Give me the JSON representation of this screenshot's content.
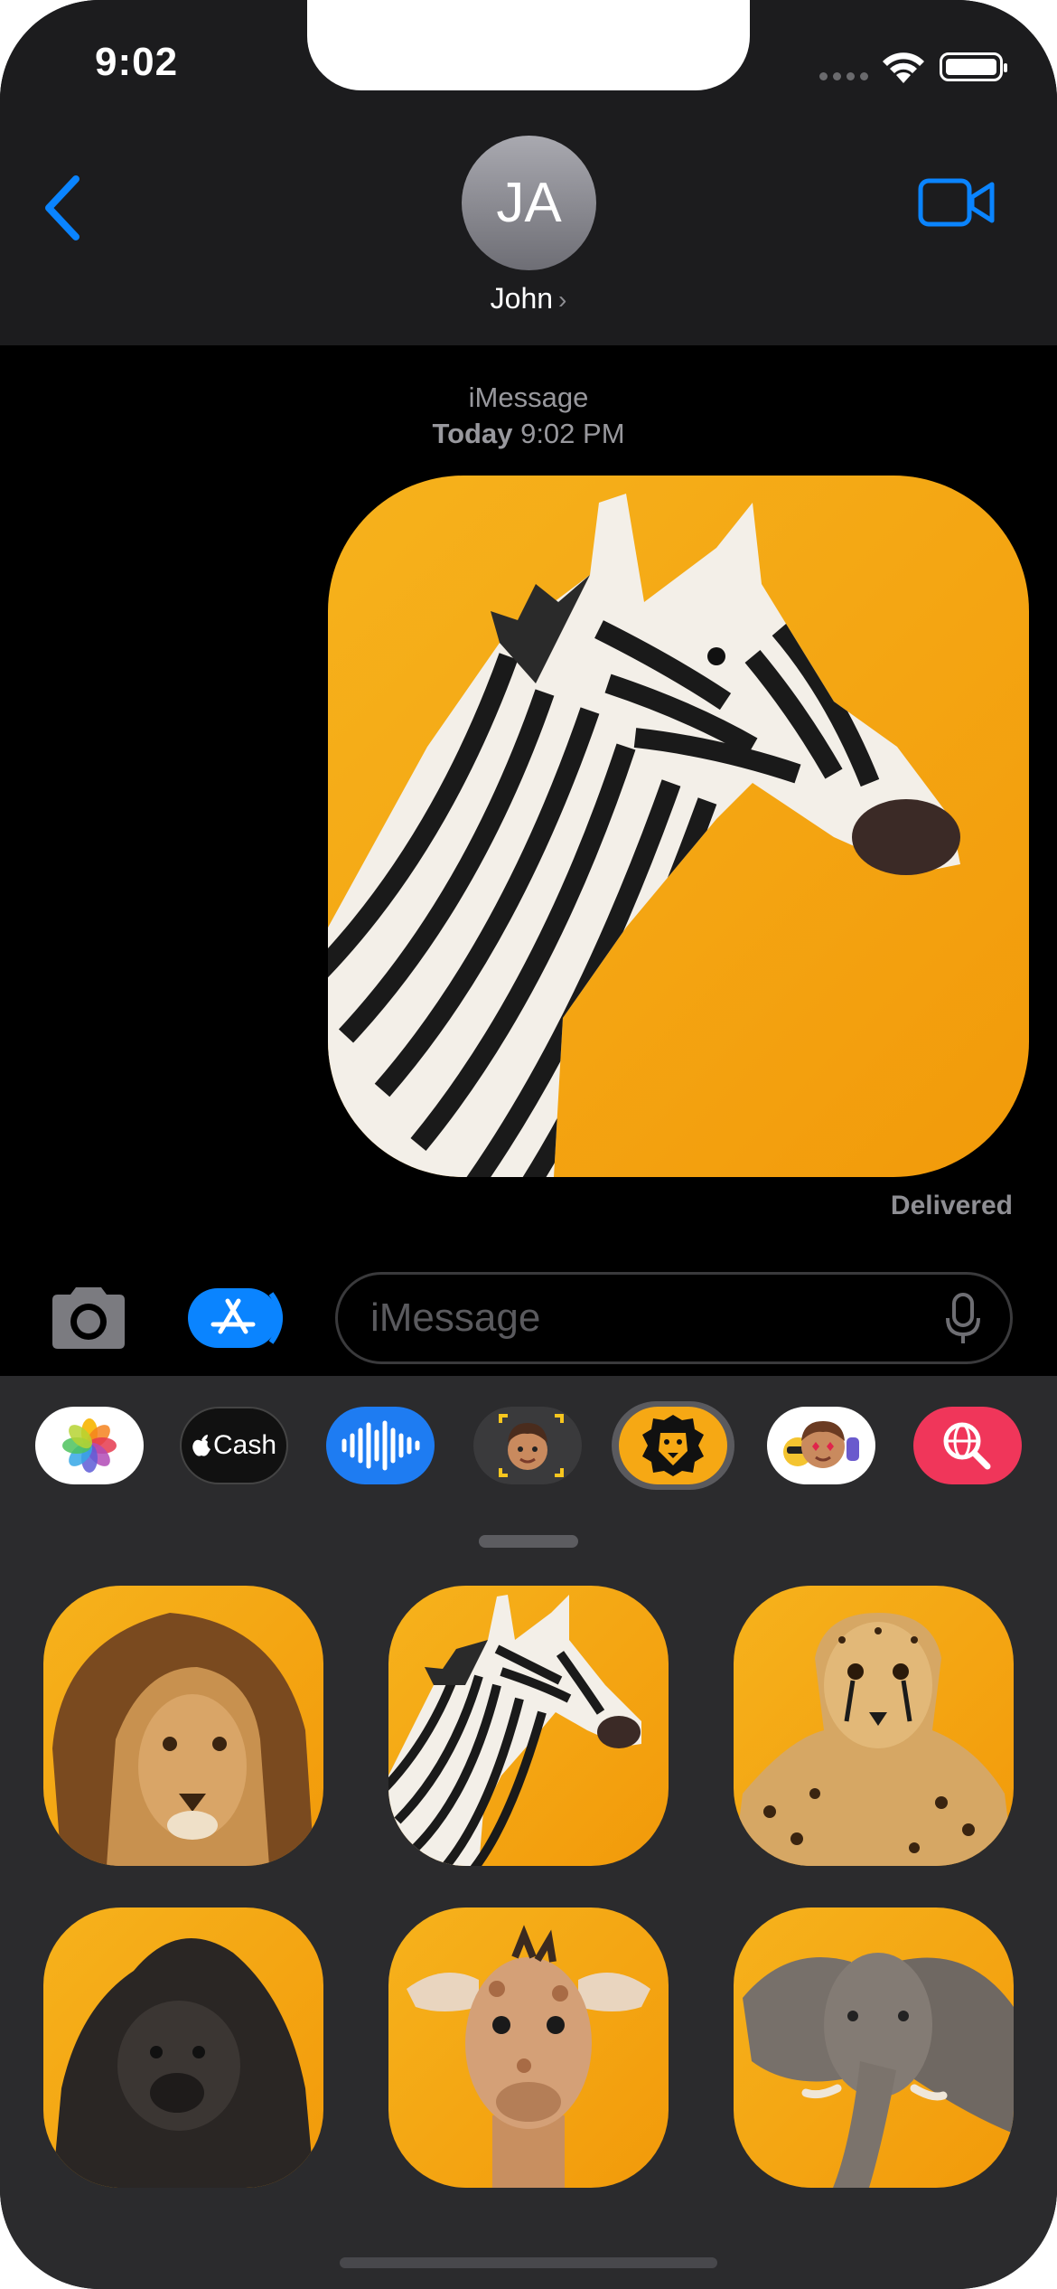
{
  "status_bar": {
    "time": "9:02"
  },
  "nav": {
    "avatar_initials": "JA",
    "contact_name": "John",
    "contact_chevron": "›"
  },
  "conversation": {
    "service": "iMessage",
    "timestamp_day": "Today",
    "timestamp_time": "9:02 PM",
    "message_sticker": "zebra",
    "delivery_status": "Delivered"
  },
  "input_bar": {
    "placeholder": "iMessage"
  },
  "app_drawer": {
    "apps": [
      {
        "name": "Photos",
        "icon": "photos-icon"
      },
      {
        "name": "Cash",
        "label": "Cash",
        "icon": "apple-cash-icon"
      },
      {
        "name": "Audio",
        "icon": "waveform-icon"
      },
      {
        "name": "Memoji",
        "icon": "memoji-icon"
      },
      {
        "name": "Animal Stickers",
        "icon": "lion-icon",
        "selected": true
      },
      {
        "name": "Memoji Stickers",
        "icon": "memoji-stickers-icon"
      },
      {
        "name": "Images",
        "icon": "globe-search-icon"
      }
    ],
    "stickers": [
      "lion",
      "zebra",
      "cheetah",
      "gorilla",
      "giraffe",
      "elephant"
    ]
  },
  "colors": {
    "accent": "#0a84ff",
    "sticker_background": "#f6b21c",
    "header_bg": "#1c1c1e",
    "drawer_bg": "#2b2b2d"
  }
}
